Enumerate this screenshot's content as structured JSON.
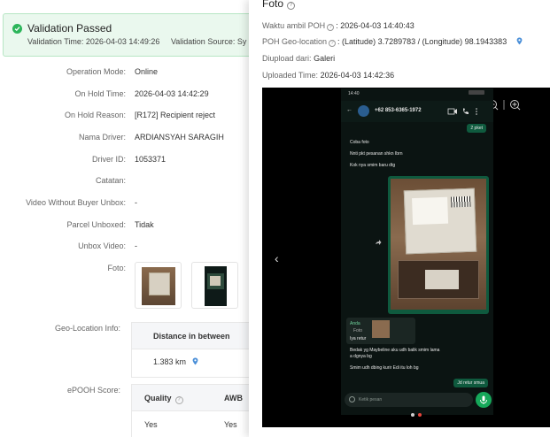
{
  "validation": {
    "title": "Validation Passed",
    "time_text": "Validation Time: 2026-04-03 14:49:26",
    "source_text": "Validation Source: Sy"
  },
  "details": [
    {
      "label": "Operation Mode:",
      "value": "Online"
    },
    {
      "label": "On Hold Time:",
      "value": "2026-04-03 14:42:29"
    },
    {
      "label": "On Hold Reason:",
      "value": "[R172] Recipient reject"
    },
    {
      "label": "Nama Driver:",
      "value": "ARDIANSYAH SARAGIH"
    },
    {
      "label": "Driver ID:",
      "value": "1053371"
    },
    {
      "label": "Catatan:",
      "value": ""
    },
    {
      "label": "Video Without Buyer Unbox:",
      "value": "-"
    },
    {
      "label": "Parcel Unboxed:",
      "value": "Tidak"
    },
    {
      "label": "Unbox Video:",
      "value": "-"
    }
  ],
  "foto_label": "Foto:",
  "geo": {
    "label": "Geo-Location Info:",
    "column": "Distance in between",
    "distance": "1.383 km"
  },
  "epooh": {
    "label": "ePOOH Score:",
    "columns": [
      "Quality",
      "AWB"
    ],
    "values": [
      "Yes",
      "Yes"
    ]
  },
  "panel": {
    "title": "Foto",
    "waktu_key": "Waktu ambil POH",
    "waktu_val": ": 2026-04-03 14:40:43",
    "geo_key": "POH Geo-location",
    "geo_val": ": (Latitude) 3.7289783 / (Longitude) 98.1943383",
    "upload_key": "Diupload dari:",
    "upload_val": "Galeri",
    "uploaded_key": "Uploaded Time:",
    "uploaded_val": "2026-04-03 14:42:36"
  },
  "phone": {
    "status_time": "14:40",
    "contact": "+62 853-6365-1972",
    "msgs_in": [
      "Coba foto",
      "Nnti pkt pesanan shkn Ibrn",
      "Kok nya smim baru dtg"
    ],
    "msg_out_top": "2 pket",
    "reply_name": "Anda",
    "reply_sub": "Foto",
    "msg_in_after": "Iya retur",
    "msg_long_1": "Bedak yg Maybeline aku udh balik smim lama",
    "msg_long_2": "a dgnya bg",
    "msg_long_3": "Smim udh dbing kurir Edi itu loh bg",
    "msg_out_bottom": "Jd retur smua",
    "compose_placeholder": "Ketik pesan"
  },
  "colors": {
    "success": "#2cb55a",
    "banner_bg": "#eaf8ee",
    "wa_green": "#0f5a3e",
    "dot_active": "#e8453c"
  }
}
